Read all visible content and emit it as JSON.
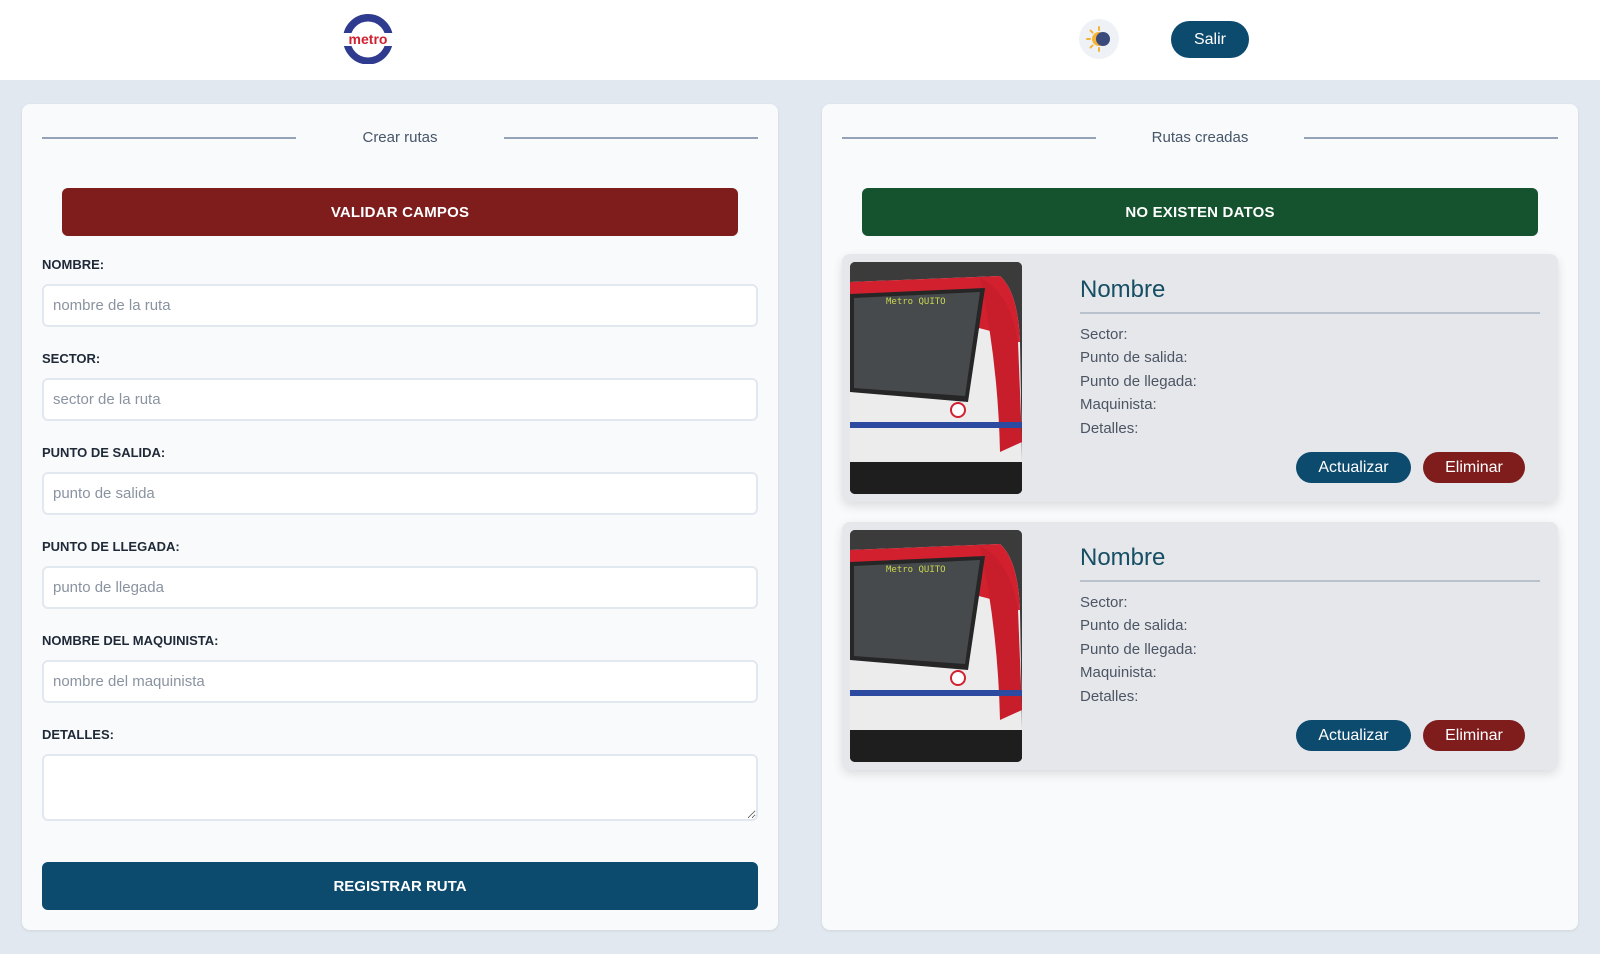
{
  "header": {
    "logo_text": "metro",
    "logout_label": "Salir",
    "theme_toggle_icon": "sun-moon-icon"
  },
  "create_panel": {
    "title": "Crear rutas",
    "alert": "VALIDAR CAMPOS",
    "fields": [
      {
        "label": "NOMBRE:",
        "placeholder": "nombre de la ruta",
        "value": ""
      },
      {
        "label": "SECTOR:",
        "placeholder": "sector de la ruta",
        "value": ""
      },
      {
        "label": "PUNTO DE SALIDA:",
        "placeholder": "punto de salida",
        "value": ""
      },
      {
        "label": "PUNTO DE LLEGADA:",
        "placeholder": "punto de llegada",
        "value": ""
      },
      {
        "label": "NOMBRE DEL MAQUINISTA:",
        "placeholder": "nombre del maquinista",
        "value": ""
      },
      {
        "label": "DETALLES:",
        "placeholder": "",
        "value": ""
      }
    ],
    "submit_label": "REGISTRAR RUTA"
  },
  "routes_panel": {
    "title": "Rutas creadas",
    "alert": "NO EXISTEN DATOS",
    "cards": [
      {
        "image_caption": "Metro QUITO",
        "name": "Nombre",
        "sector": "Sector:",
        "departure": "Punto de salida:",
        "arrival": "Punto de llegada:",
        "driver": "Maquinista:",
        "details": "Detalles:",
        "update_label": "Actualizar",
        "delete_label": "Eliminar"
      },
      {
        "image_caption": "Metro QUITO",
        "name": "Nombre",
        "sector": "Sector:",
        "departure": "Punto de salida:",
        "arrival": "Punto de llegada:",
        "driver": "Maquinista:",
        "details": "Detalles:",
        "update_label": "Actualizar",
        "delete_label": "Eliminar"
      }
    ]
  },
  "colors": {
    "primary": "#0c4a6e",
    "danger": "#7f1d1d",
    "success": "#14532d",
    "background": "#e2e8f0",
    "card": "#f8fafc"
  }
}
